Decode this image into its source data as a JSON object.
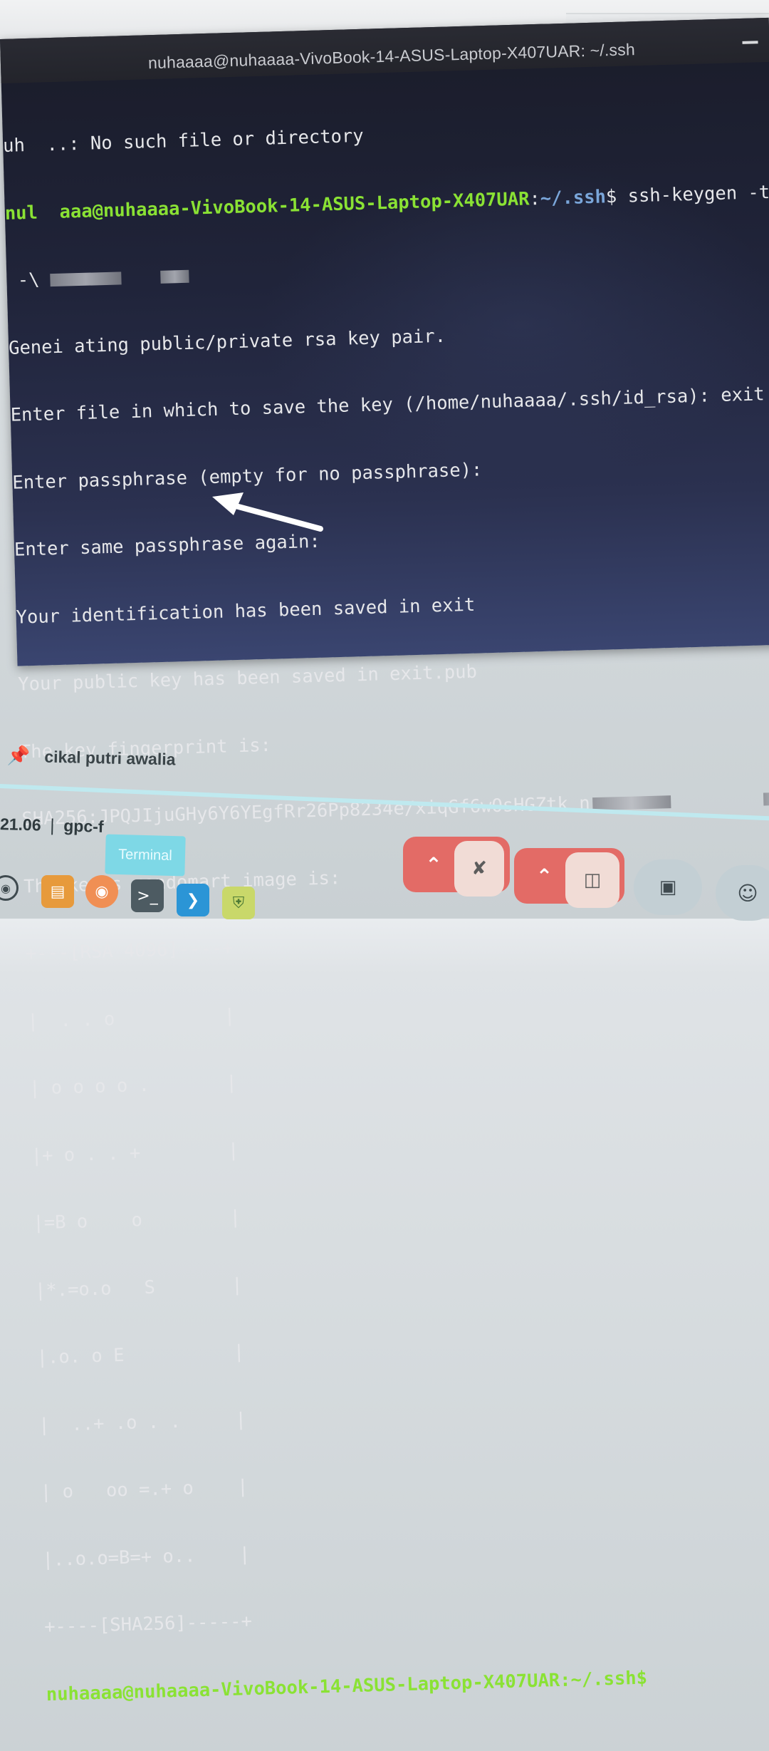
{
  "window": {
    "title": "nuhaaaa@nuhaaaa-VivoBook-14-ASUS-Laptop-X407UAR: ~/.ssh"
  },
  "terminal": {
    "l1": "uh  ..: No such file or directory",
    "l2_prompt_user": "nul  aaa@nuhaaaa-VivoBook-14-ASUS-Laptop-X407UAR",
    "l2_prompt_sep": ":",
    "l2_prompt_path": "~/.ssh",
    "l2_prompt_end": "$ ",
    "l2_cmd": "ssh-keygen -t rsa",
    "l3": " -\\",
    "l4": "Genei ating public/private rsa key pair.",
    "l5": "Enter file in which to save the key (/home/nuhaaaa/.ssh/id_rsa): exit",
    "l6": "Enter passphrase (empty for no passphrase):",
    "l7": "Enter same passphrase again:",
    "l8": "Your identification has been saved in exit",
    "l9": "Your public key has been saved in exit.pub",
    "l10": "The key fingerprint is:",
    "l11": "SHA256:JPQJIjuGHy6Y6YEgfRr26Pp8234e/xiqGf6wOsHGZtk n",
    "l12": "The key's randomart image is:",
    "art": [
      "+---[RSA 4096]----+",
      "|  . . o          |",
      "| o o o o .       |",
      "|+ o . . +        |",
      "|=B o    o        |",
      "|*.=o.o   S       |",
      "|.o. o E          |",
      "|  ..+ .o . .     |",
      "| o   oo =.+ o    |",
      "|..o.o=B=+ o..    |",
      "+----[SHA256]-----+"
    ],
    "final_prompt": "nuhaaaa@nuhaaaa-VivoBook-14-ASUS-Laptop-X407UAR:~/.ssh$"
  },
  "meeting": {
    "pinned_name": "cikal putri awalia",
    "time": "21.06",
    "separator": "|",
    "meeting_code": "gpc-f"
  },
  "taskbar": {
    "tooltip": "Terminal"
  },
  "colors": {
    "prompt_green": "#8ae234",
    "prompt_blue": "#7aa6da",
    "control_red": "#e36b66"
  }
}
